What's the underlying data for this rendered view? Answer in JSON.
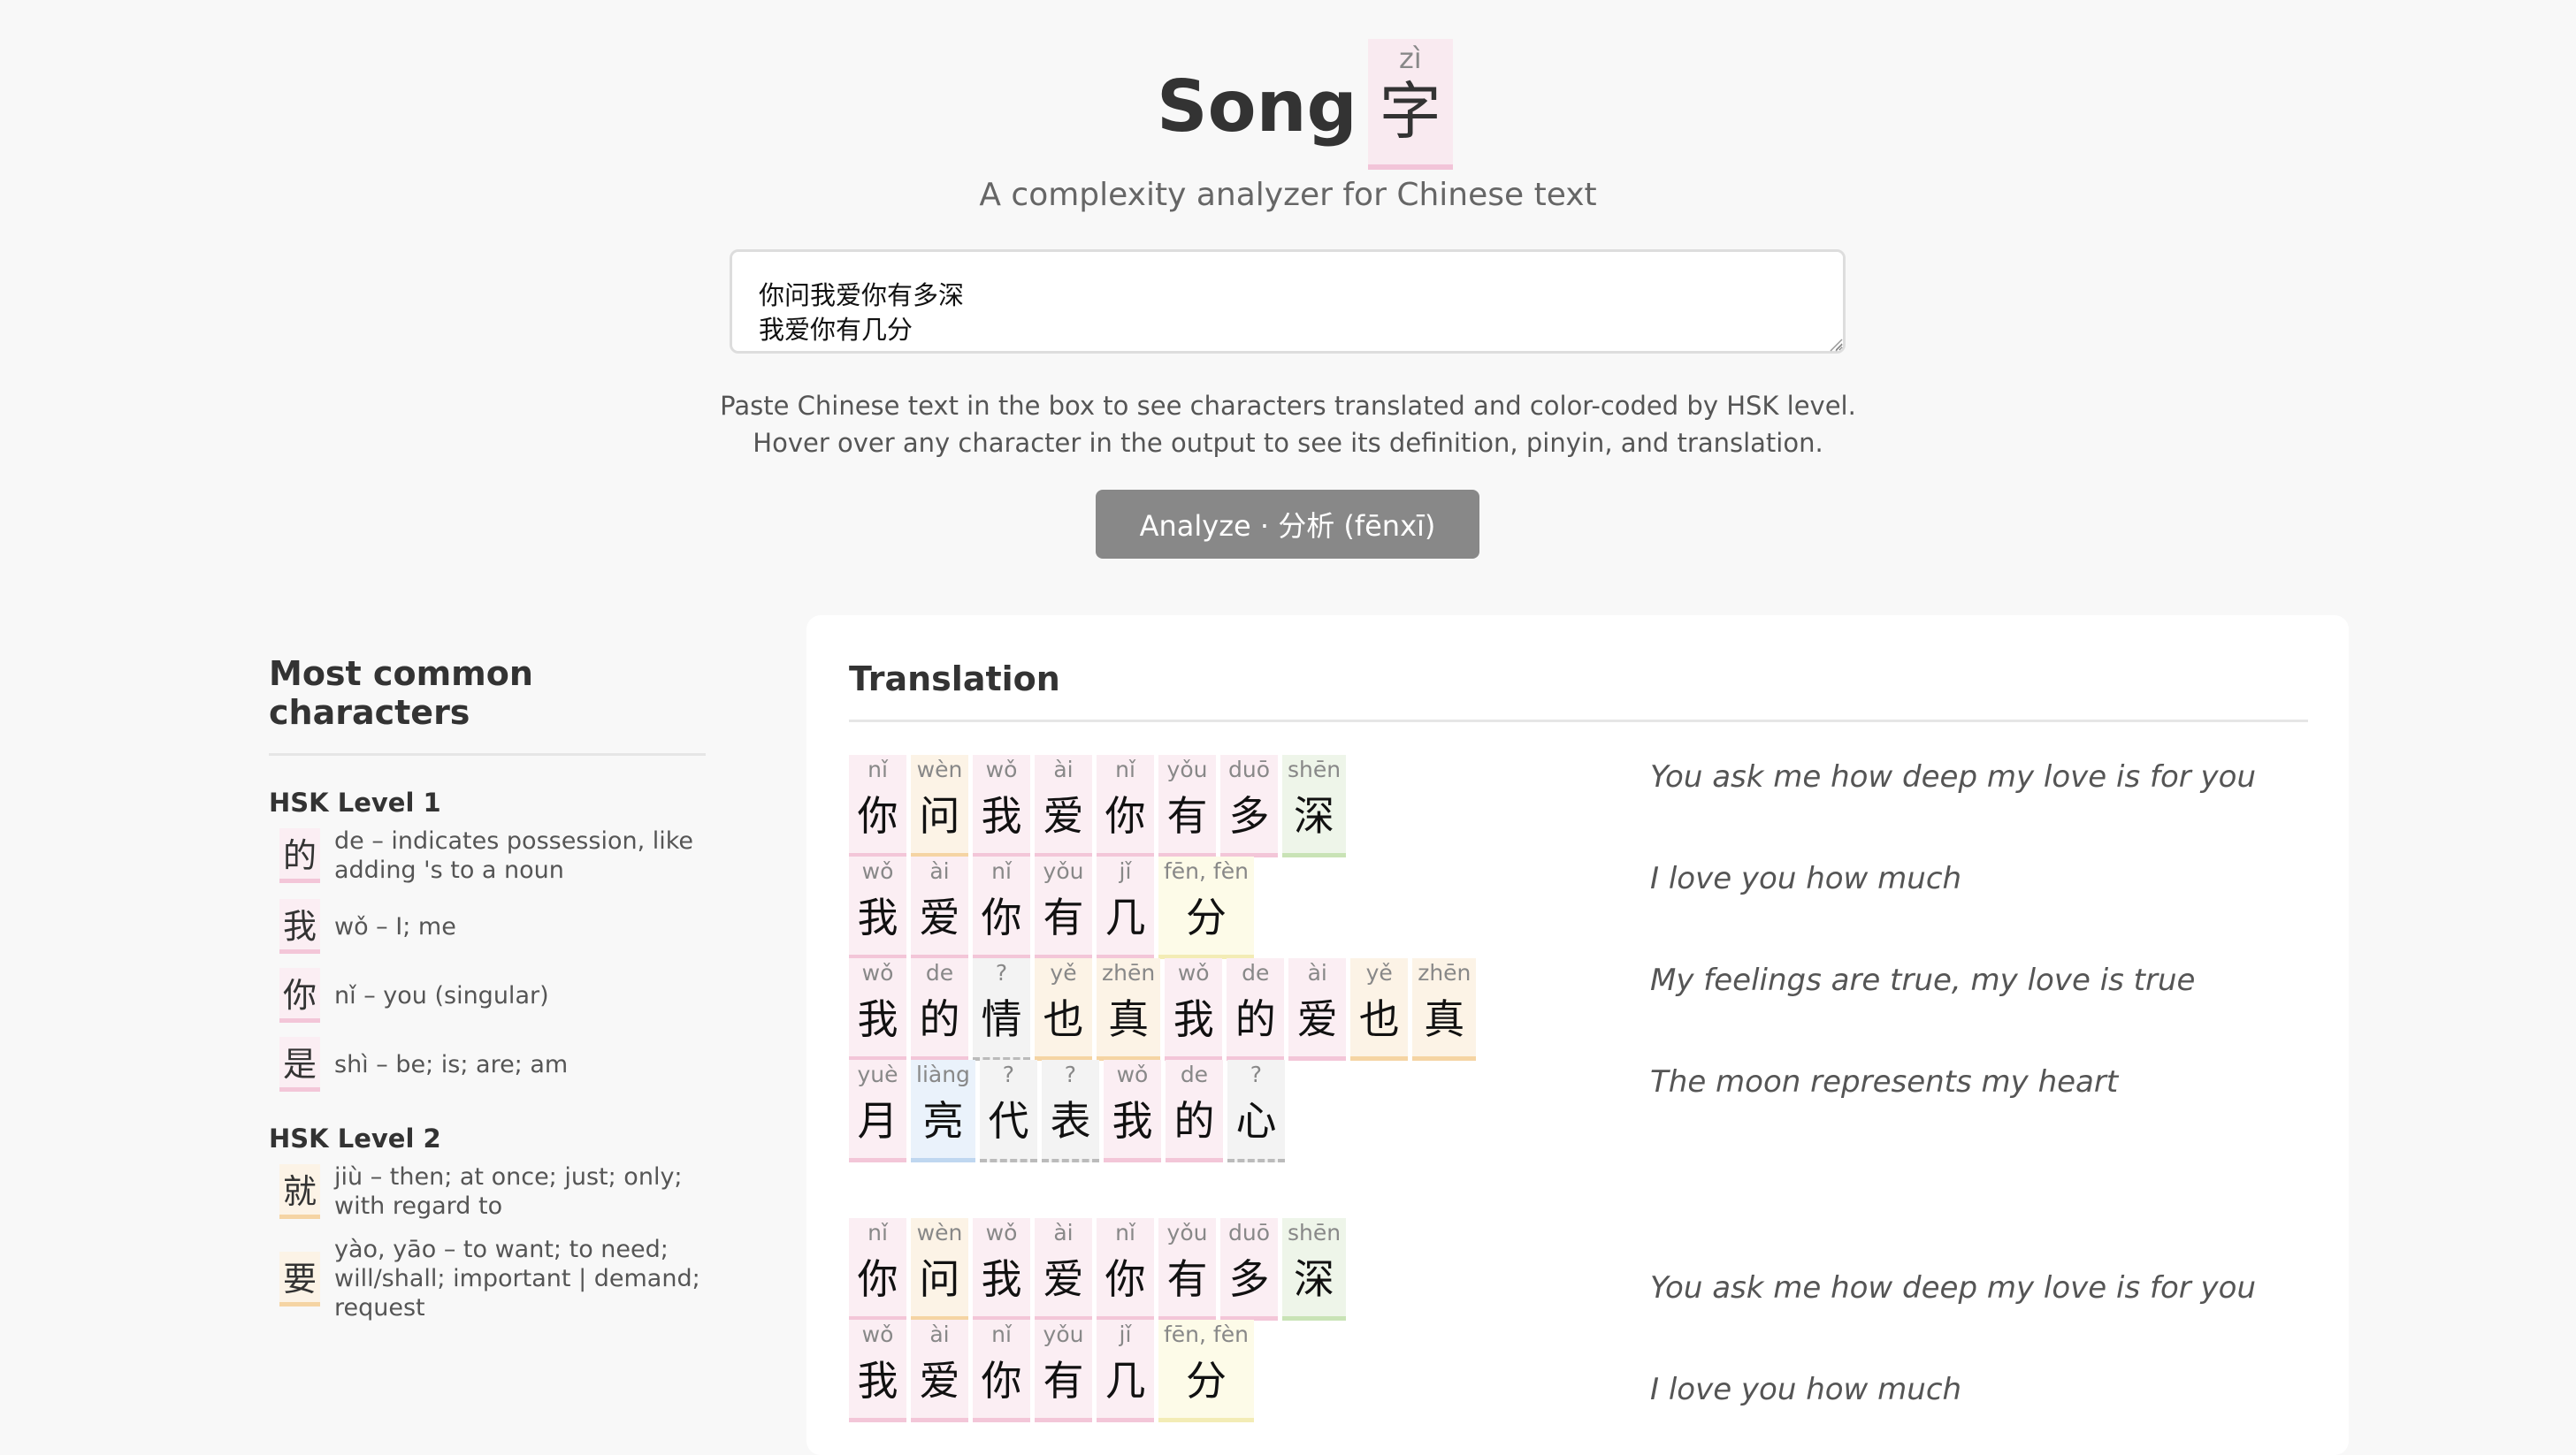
{
  "logo": {
    "word": "Song",
    "char": "字",
    "pinyin": "zì"
  },
  "tagline": "A complexity analyzer for Chinese text",
  "input": {
    "value": "你问我爱你有多深\n我爱你有几分"
  },
  "help": [
    "Paste Chinese text in the box to see characters translated and color-coded by HSK level.",
    "Hover over any character in the output to see its definition, pinyin, and translation."
  ],
  "analyze_label": "Analyze · 分析 (fēnxī)",
  "sidebar": {
    "title": "Most common characters",
    "levels": [
      {
        "heading": "HSK Level 1",
        "items": [
          {
            "char": "的",
            "def": "de – indicates possession, like adding 's to a noun"
          },
          {
            "char": "我",
            "def": "wǒ – I; me"
          },
          {
            "char": "你",
            "def": "nǐ – you (singular)"
          },
          {
            "char": "是",
            "def": "shì – be; is; are; am"
          }
        ]
      },
      {
        "heading": "HSK Level 2",
        "items": [
          {
            "char": "就",
            "def": "jiù – then; at once; just; only; with regard to"
          },
          {
            "char": "要",
            "def": "yào, yāo – to want; to need; will/shall; important | demand; request"
          }
        ]
      }
    ]
  },
  "translation": {
    "title": "Translation",
    "lines": [
      {
        "chars": [
          {
            "py": "nǐ",
            "ch": "你",
            "lv": "l1"
          },
          {
            "py": "wèn",
            "ch": "问",
            "lv": "l2"
          },
          {
            "py": "wǒ",
            "ch": "我",
            "lv": "l1"
          },
          {
            "py": "ài",
            "ch": "爱",
            "lv": "l1"
          },
          {
            "py": "nǐ",
            "ch": "你",
            "lv": "l1"
          },
          {
            "py": "yǒu",
            "ch": "有",
            "lv": "l1"
          },
          {
            "py": "duō",
            "ch": "多",
            "lv": "l1"
          },
          {
            "py": "shēn",
            "ch": "深",
            "lv": "l4"
          }
        ],
        "text": "You ask me how deep my love is for you"
      },
      {
        "chars": [
          {
            "py": "wǒ",
            "ch": "我",
            "lv": "l1"
          },
          {
            "py": "ài",
            "ch": "爱",
            "lv": "l1"
          },
          {
            "py": "nǐ",
            "ch": "你",
            "lv": "l1"
          },
          {
            "py": "yǒu",
            "ch": "有",
            "lv": "l1"
          },
          {
            "py": "jǐ",
            "ch": "几",
            "lv": "l1"
          },
          {
            "py": "fēn, fèn",
            "ch": "分",
            "lv": "l3"
          }
        ],
        "text": "I love you how much"
      },
      {
        "chars": [
          {
            "py": "wǒ",
            "ch": "我",
            "lv": "l1"
          },
          {
            "py": "de",
            "ch": "的",
            "lv": "l1"
          },
          {
            "py": "?",
            "ch": "情",
            "lv": "unk"
          },
          {
            "py": "yě",
            "ch": "也",
            "lv": "l2"
          },
          {
            "py": "zhēn",
            "ch": "真",
            "lv": "l2"
          },
          {
            "py": "wǒ",
            "ch": "我",
            "lv": "l1"
          },
          {
            "py": "de",
            "ch": "的",
            "lv": "l1"
          },
          {
            "py": "ài",
            "ch": "爱",
            "lv": "l1"
          },
          {
            "py": "yě",
            "ch": "也",
            "lv": "l2"
          },
          {
            "py": "zhēn",
            "ch": "真",
            "lv": "l2"
          }
        ],
        "text": "My feelings are true, my love is true"
      },
      {
        "chars": [
          {
            "py": "yuè",
            "ch": "月",
            "lv": "l1"
          },
          {
            "py": "liàng",
            "ch": "亮",
            "lv": "l5"
          },
          {
            "py": "?",
            "ch": "代",
            "lv": "unk"
          },
          {
            "py": "?",
            "ch": "表",
            "lv": "unk"
          },
          {
            "py": "wǒ",
            "ch": "我",
            "lv": "l1"
          },
          {
            "py": "de",
            "ch": "的",
            "lv": "l1"
          },
          {
            "py": "?",
            "ch": "心",
            "lv": "unk"
          }
        ],
        "text": "The moon represents my heart"
      },
      {
        "chars": [
          {
            "py": "nǐ",
            "ch": "你",
            "lv": "l1"
          },
          {
            "py": "wèn",
            "ch": "问",
            "lv": "l2"
          },
          {
            "py": "wǒ",
            "ch": "我",
            "lv": "l1"
          },
          {
            "py": "ài",
            "ch": "爱",
            "lv": "l1"
          },
          {
            "py": "nǐ",
            "ch": "你",
            "lv": "l1"
          },
          {
            "py": "yǒu",
            "ch": "有",
            "lv": "l1"
          },
          {
            "py": "duō",
            "ch": "多",
            "lv": "l1"
          },
          {
            "py": "shēn",
            "ch": "深",
            "lv": "l4"
          }
        ],
        "text": "You ask me how deep my love is for you"
      },
      {
        "chars": [
          {
            "py": "wǒ",
            "ch": "我",
            "lv": "l1"
          },
          {
            "py": "ài",
            "ch": "爱",
            "lv": "l1"
          },
          {
            "py": "nǐ",
            "ch": "你",
            "lv": "l1"
          },
          {
            "py": "yǒu",
            "ch": "有",
            "lv": "l1"
          },
          {
            "py": "jǐ",
            "ch": "几",
            "lv": "l1"
          },
          {
            "py": "fēn, fèn",
            "ch": "分",
            "lv": "l3"
          }
        ],
        "text": "I love you how much"
      }
    ]
  }
}
